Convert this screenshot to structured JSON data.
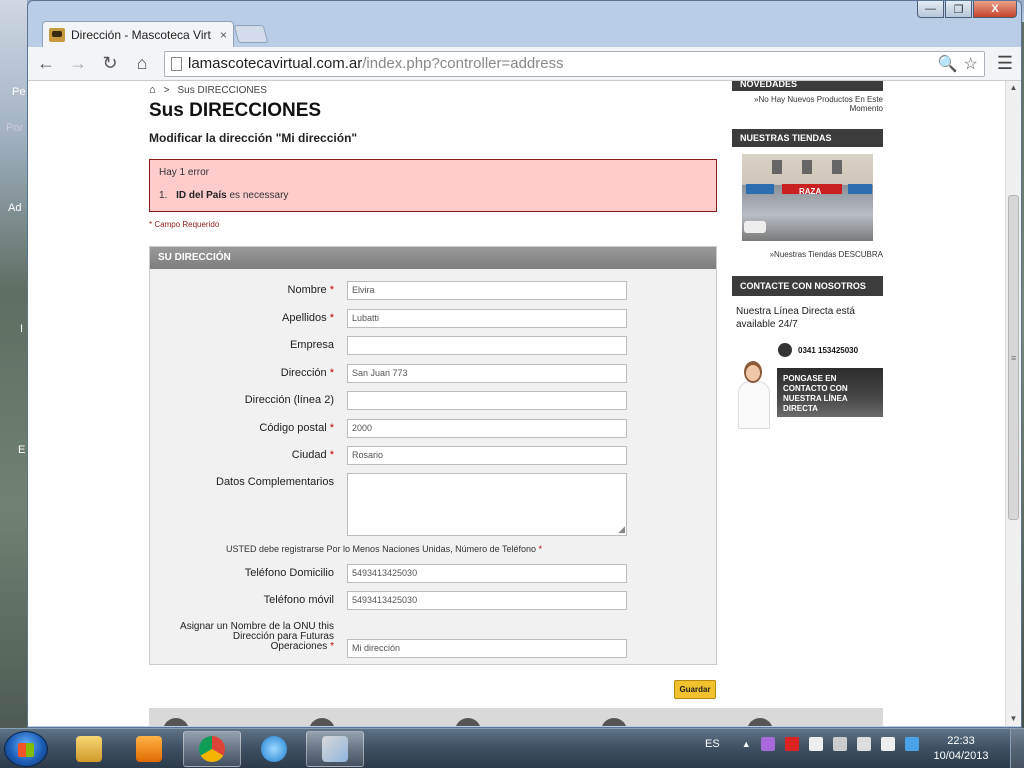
{
  "desktop": {
    "left_fragments": [
      "Pe",
      "Por",
      "Ad",
      "I",
      "E"
    ]
  },
  "browser": {
    "tab_title": "Dirección - Mascoteca Virt",
    "tab_close": "×",
    "url_host": "lamascotecavirtual.com.ar",
    "url_path": "/index.php?controller=address",
    "win_minimize": "—",
    "win_maximize": "❐",
    "win_close": "X",
    "icons": {
      "back": "←",
      "forward": "→",
      "reload": "↻",
      "home": "⌂",
      "search": "🔍",
      "star": "☆",
      "menu": "☰"
    }
  },
  "page": {
    "breadcrumb": {
      "home_icon": "⌂",
      "separator": ">",
      "current": "Sus DIRECCIONES"
    },
    "title": "Sus DIRECCIONES",
    "subtitle": "Modificar la dirección \"Mi dirección\"",
    "error": {
      "heading": "Hay 1 error",
      "item_number": "1.",
      "item_field": "ID del País",
      "item_text": "es necessary"
    },
    "required_note": "* Campo Requerido",
    "form": {
      "legend": "SU DIRECCIÓN",
      "fields": [
        {
          "label": "Nombre",
          "required": true,
          "value": "Elvira"
        },
        {
          "label": "Apellidos",
          "required": true,
          "value": "Lubatti"
        },
        {
          "label": "Empresa",
          "required": false,
          "value": ""
        },
        {
          "label": "Dirección",
          "required": true,
          "value": "San Juan 773"
        },
        {
          "label": "Dirección (línea 2)",
          "required": false,
          "value": ""
        },
        {
          "label": "Código postal",
          "required": true,
          "value": "2000"
        },
        {
          "label": "Ciudad",
          "required": true,
          "value": "Rosario"
        }
      ],
      "complementary_label": "Datos Complementarios",
      "complementary_value": "",
      "phone_notice": "USTED debe registrarse Por lo Menos Naciones Unidas, Número de Teléfono",
      "home_phone_label": "Teléfono Domicilio",
      "home_phone_value": "5493413425030",
      "mobile_label": "Teléfono móvil",
      "mobile_value": "5493413425030",
      "alias_label_1": "Asignar un Nombre de la ONU this",
      "alias_label_2": "Dirección para Futuras",
      "alias_label_3": "Operaciones",
      "alias_value": "Mi dirección",
      "required_mark": "*",
      "save_label": "Guardar"
    }
  },
  "sidebar": {
    "news_head": "NOVEDADES",
    "news_text_1": "»No Hay Nuevos Productos En Este",
    "news_text_2": "Momento",
    "stores_head": "NUESTRAS TIENDAS",
    "store_sign": "RAZA",
    "stores_link": "»Nuestras Tiendas DESCUBRA",
    "contact_head": "CONTACTE CON NOSOTROS",
    "contact_text_1": "Nuestra Línea Directa está",
    "contact_text_2": "available 24/7",
    "phone": "0341 153425030",
    "contact_button": "PONGASE EN CONTACTO CON NUESTRA LÍNEA DIRECTA"
  },
  "taskbar": {
    "language": "ES",
    "time": "22:33",
    "date": "10/04/2013"
  },
  "colors": {
    "accent_button": "#f2c12e",
    "error_bg": "#ffcccc",
    "sidebar_head": "#3c3c3c",
    "required": "#c20000"
  }
}
